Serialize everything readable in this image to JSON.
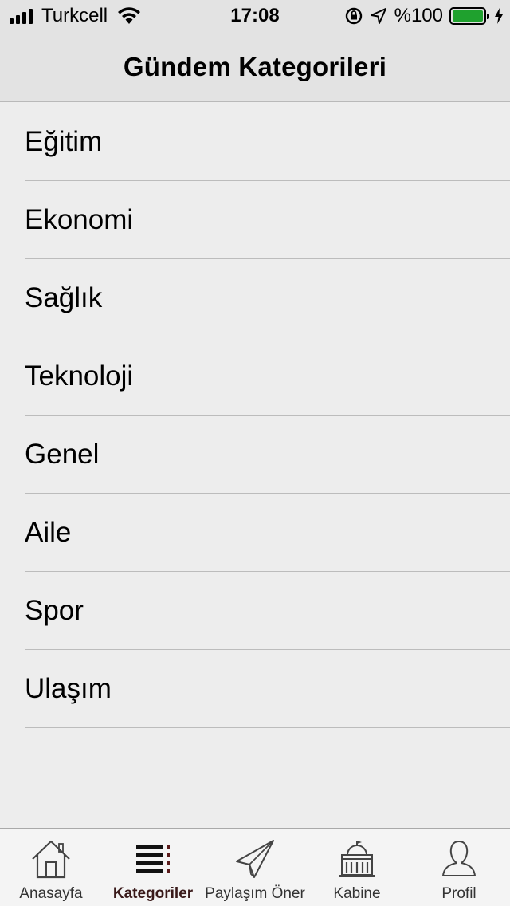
{
  "status_bar": {
    "carrier": "Turkcell",
    "time": "17:08",
    "battery_percent": "%100",
    "icons": [
      "signal-icon",
      "wifi-icon",
      "rotation-lock-icon",
      "location-icon",
      "battery-icon",
      "charging-icon"
    ]
  },
  "nav": {
    "title": "Gündem Kategorileri"
  },
  "categories": [
    {
      "label": "Eğitim"
    },
    {
      "label": "Ekonomi"
    },
    {
      "label": "Sağlık"
    },
    {
      "label": "Teknoloji"
    },
    {
      "label": "Genel"
    },
    {
      "label": "Aile"
    },
    {
      "label": "Spor"
    },
    {
      "label": "Ulaşım"
    }
  ],
  "tabs": [
    {
      "label": "Anasayfa",
      "icon": "home-icon"
    },
    {
      "label": "Kategoriler",
      "icon": "list-icon",
      "active": true
    },
    {
      "label": "Paylaşım Öner",
      "icon": "paper-plane-icon"
    },
    {
      "label": "Kabine",
      "icon": "parliament-icon"
    },
    {
      "label": "Profil",
      "icon": "person-icon"
    }
  ],
  "colors": {
    "background": "#ededed",
    "bar_background": "#e3e3e3",
    "tab_bar_background": "#f4f4f4",
    "battery_fill": "#1fa12e",
    "active_tab_text": "#3a1a1a"
  }
}
